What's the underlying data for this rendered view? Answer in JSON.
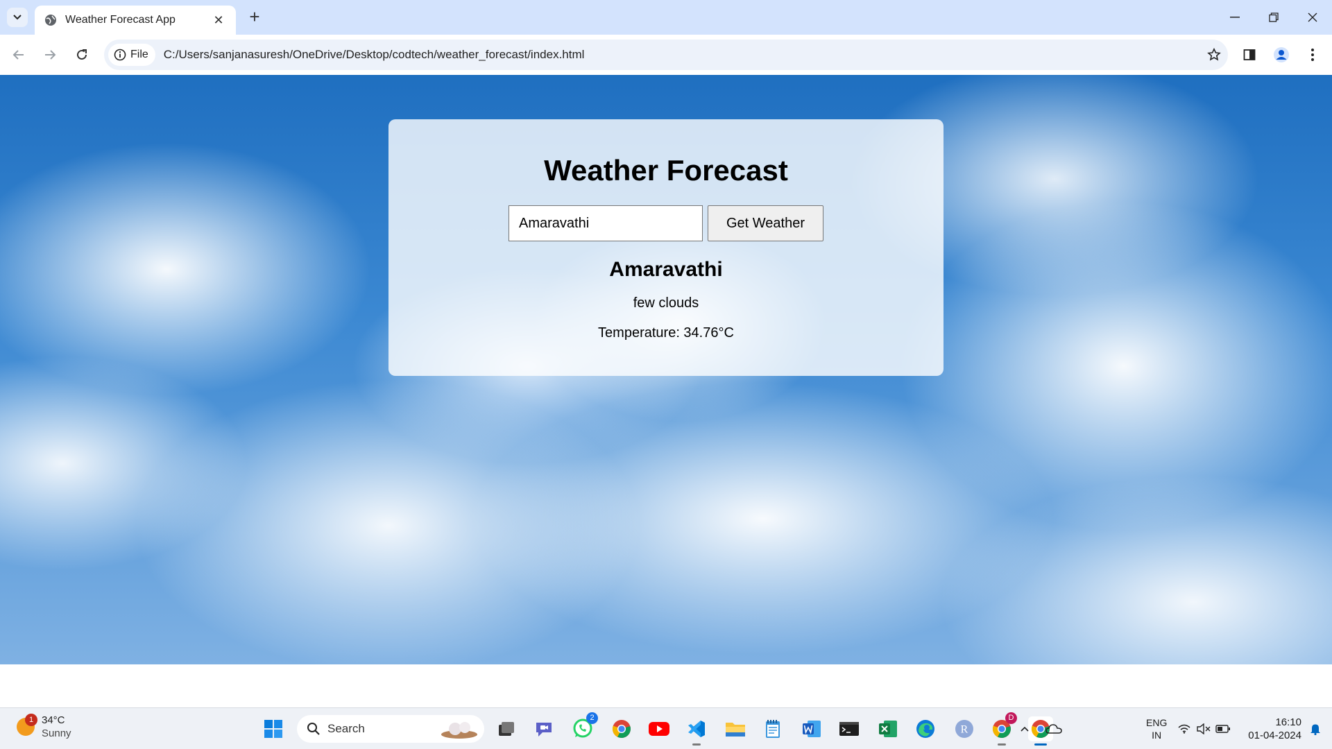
{
  "browser": {
    "tab_title": "Weather Forecast App",
    "omnibox_chip": "File",
    "url": "C:/Users/sanjanasuresh/OneDrive/Desktop/codtech/weather_forecast/index.html"
  },
  "page": {
    "title": "Weather Forecast",
    "city_input_value": "Amaravathi",
    "button_label": "Get Weather",
    "result_city": "Amaravathi",
    "result_description": "few clouds",
    "result_temperature": "Temperature: 34.76°C"
  },
  "taskbar": {
    "weather_temp": "34°C",
    "weather_condition": "Sunny",
    "weather_badge": "1",
    "search_label": "Search",
    "whatsapp_badge": "2",
    "chrome_profile_badge": "D",
    "lang_line1": "ENG",
    "lang_line2": "IN",
    "time": "16:10",
    "date": "01-04-2024"
  },
  "colors": {
    "tabstrip": "#d3e3fd",
    "sky": "#3b88d2",
    "card": "#ffffffcc"
  }
}
